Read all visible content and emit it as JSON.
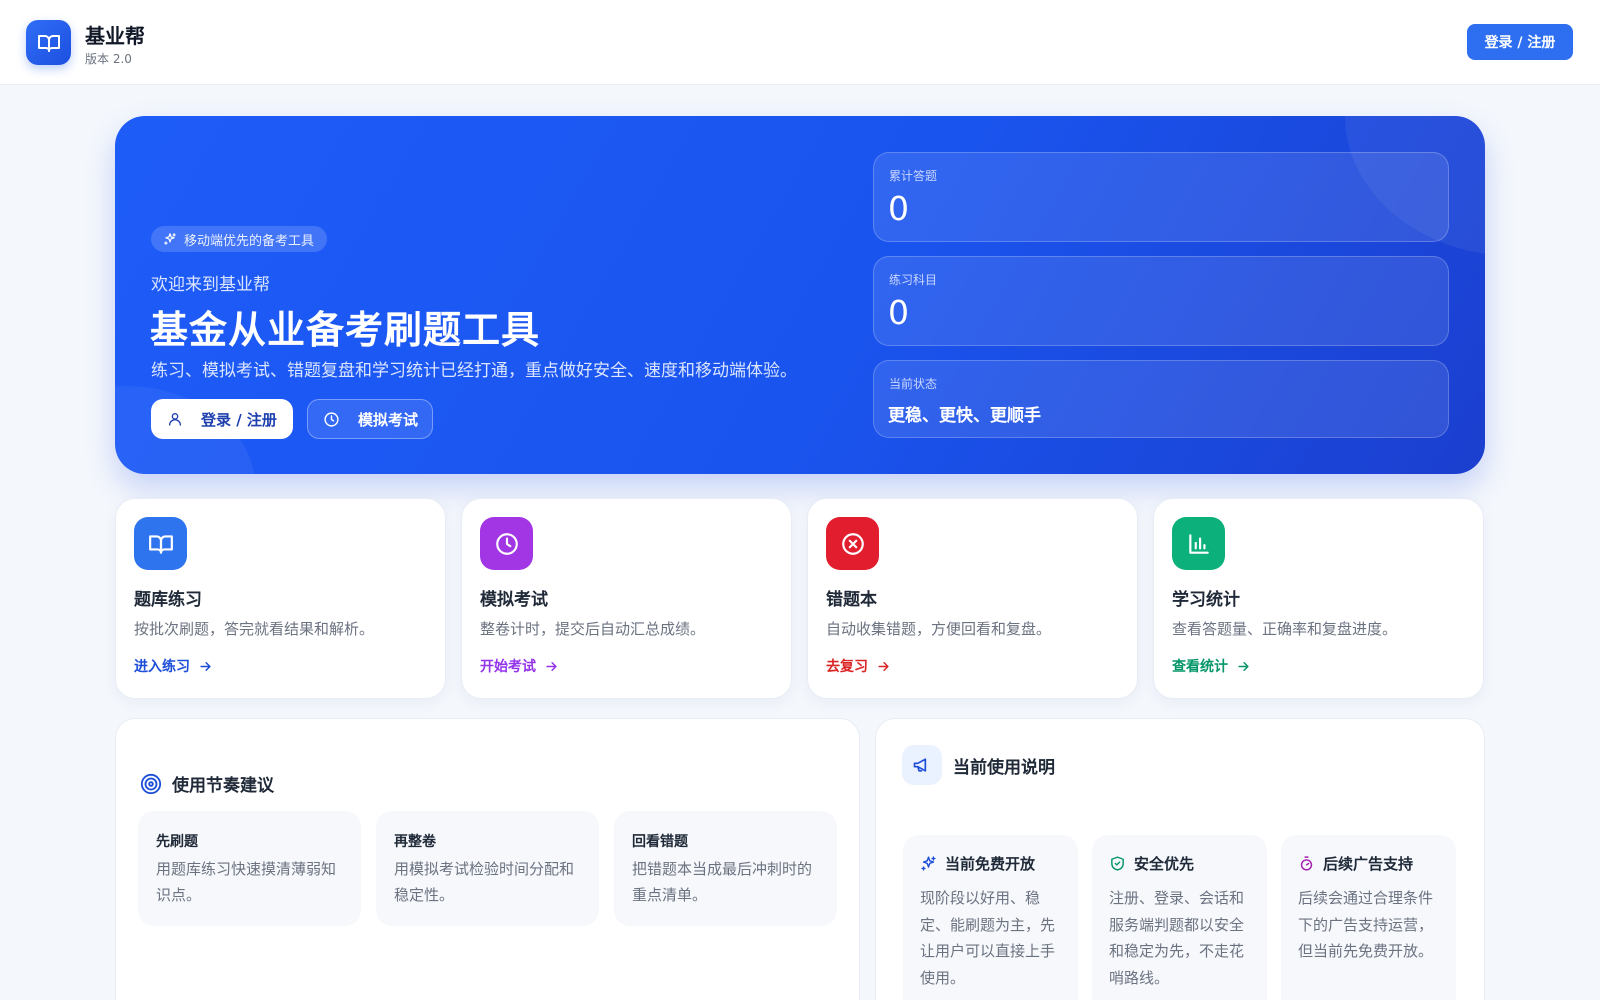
{
  "header": {
    "brand_name": "基业帮",
    "version": "版本 2.0",
    "login_button": "登录 / 注册",
    "logo_icon": "book-open-icon"
  },
  "hero": {
    "chip": "移动端优先的备考工具",
    "welcome": "欢迎来到基业帮",
    "title": "基金从业备考刷题工具",
    "description": "练习、模拟考试、错题复盘和学习统计已经打通，重点做好安全、速度和移动端体验。",
    "primary_button": "登录 / 注册",
    "secondary_button": "模拟考试",
    "stats": [
      {
        "label": "累计答题",
        "value": "0"
      },
      {
        "label": "练习科目",
        "value": "0"
      },
      {
        "label": "当前状态",
        "value": "更稳、更快、更顺手"
      }
    ]
  },
  "features": [
    {
      "title": "题库练习",
      "desc": "按批次刷题，答完就看结果和解析。",
      "link": "进入练习",
      "color": "#2e74ef",
      "icon": "book-open-icon"
    },
    {
      "title": "模拟考试",
      "desc": "整卷计时，提交后自动汇总成绩。",
      "link": "开始考试",
      "color": "#a336e4",
      "icon": "clock-icon"
    },
    {
      "title": "错题本",
      "desc": "自动收集错题，方便回看和复盘。",
      "link": "去复习",
      "color": "#e11d2e",
      "icon": "x-circle-icon"
    },
    {
      "title": "学习统计",
      "desc": "查看答题量、正确率和复盘进度。",
      "link": "查看统计",
      "color": "#059669",
      "icon": "bar-chart-icon"
    }
  ],
  "rhythm": {
    "title": "使用节奏建议",
    "cards": [
      {
        "title": "先刷题",
        "desc": "用题库练习快速摸清薄弱知识点。"
      },
      {
        "title": "再整卷",
        "desc": "用模拟考试检验时间分配和稳定性。"
      },
      {
        "title": "回看错题",
        "desc": "把错题本当成最后冲刺时的重点清单。"
      }
    ]
  },
  "usage": {
    "title": "当前使用说明",
    "cards": [
      {
        "title": "当前免费开放",
        "desc": "现阶段以好用、稳定、能刷题为主，先让用户可以直接上手使用。",
        "icon": "sparkles-icon",
        "color": "#1d4ed8"
      },
      {
        "title": "安全优先",
        "desc": "注册、登录、会话和服务端判题都以安全和稳定为先，不走花哨路线。",
        "icon": "shield-check-icon",
        "color": "#059669"
      },
      {
        "title": "后续广告支持",
        "desc": "后续会通过合理条件下的广告支持运营，但当前先免费开放。",
        "icon": "timer-icon",
        "color": "#a21caf"
      }
    ]
  }
}
